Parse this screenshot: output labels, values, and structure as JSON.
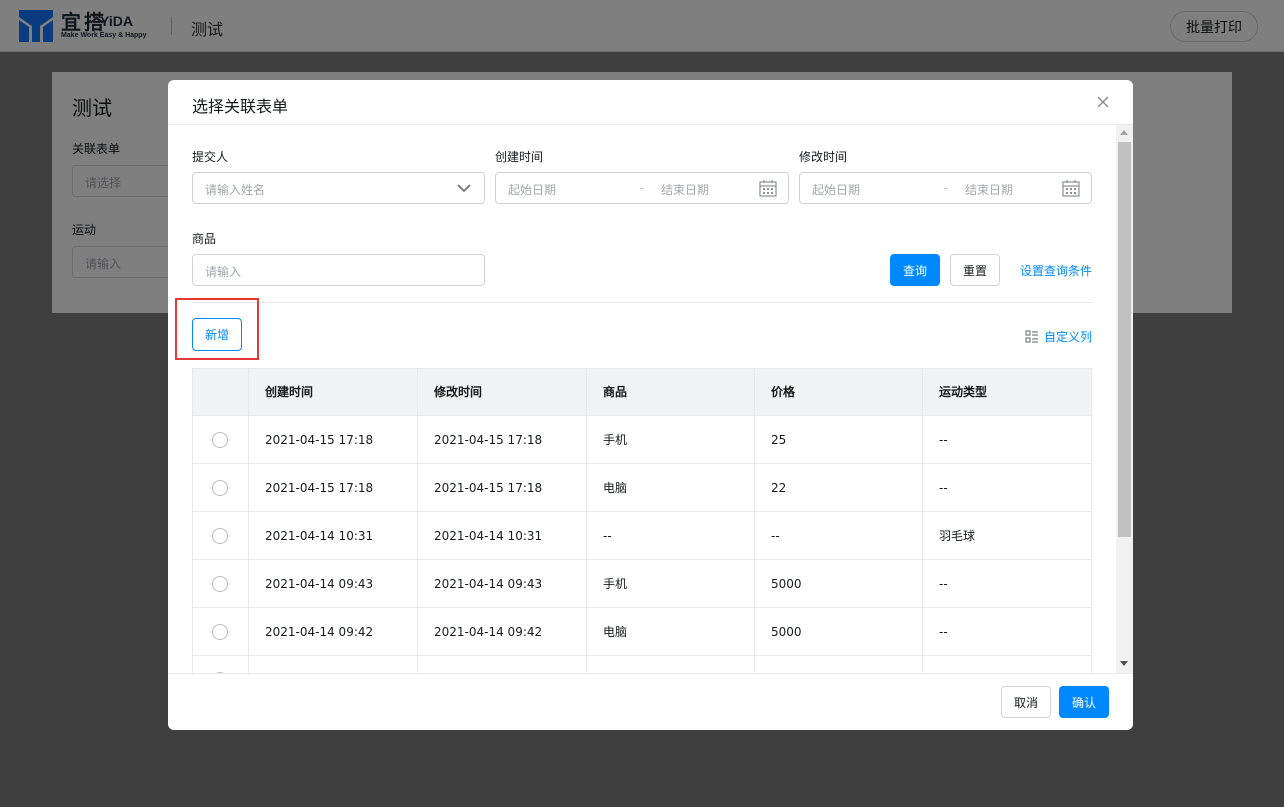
{
  "header": {
    "logo_cn": "宜搭",
    "logo_en": "YiDA",
    "logo_sub": "Make Work Easy & Happy",
    "app_title": "测试",
    "print_button": "批量打印"
  },
  "background_form": {
    "heading": "测试",
    "field1_label": "关联表单",
    "field1_placeholder": "请选择",
    "field2_label": "运动",
    "field2_placeholder": "请输入"
  },
  "dialog": {
    "title": "选择关联表单",
    "filters": {
      "submitter_label": "提交人",
      "submitter_placeholder": "请输入姓名",
      "created_label": "创建时间",
      "modified_label": "修改时间",
      "start_date": "起始日期",
      "end_date": "结束日期",
      "range_sep": "-",
      "product_label": "商品",
      "product_placeholder": "请输入"
    },
    "query_button": "查询",
    "reset_button": "重置",
    "set_conditions_link": "设置查询条件",
    "add_button": "新增",
    "custom_columns_link": "自定义列",
    "table": {
      "columns": [
        "创建时间",
        "修改时间",
        "商品",
        "价格",
        "运动类型"
      ],
      "rows": [
        [
          "2021-04-15 17:18",
          "2021-04-15 17:18",
          "手机",
          "25",
          "--"
        ],
        [
          "2021-04-15 17:18",
          "2021-04-15 17:18",
          "电脑",
          "22",
          "--"
        ],
        [
          "2021-04-14 10:31",
          "2021-04-14 10:31",
          "--",
          "--",
          "羽毛球"
        ],
        [
          "2021-04-14 09:43",
          "2021-04-14 09:43",
          "手机",
          "5000",
          "--"
        ],
        [
          "2021-04-14 09:42",
          "2021-04-14 09:42",
          "电脑",
          "5000",
          "--"
        ]
      ]
    },
    "cancel_button": "取消",
    "confirm_button": "确认"
  },
  "colors": {
    "primary": "#0089ff",
    "highlight": "#e53935",
    "logo_blue": "#1677ff"
  }
}
